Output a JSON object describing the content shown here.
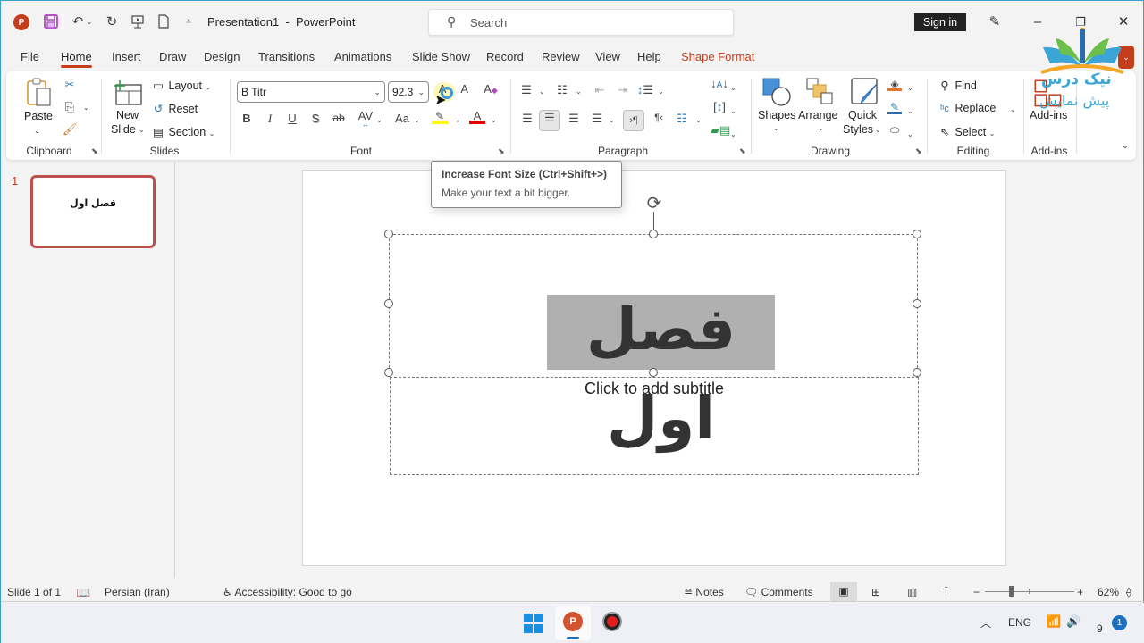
{
  "window": {
    "title": "Presentation1  -  PowerPoint",
    "search_placeholder": "Search",
    "sign_in_label": "Sign in"
  },
  "quick_access": {
    "icons": [
      "powerpoint-logo",
      "save-icon",
      "undo-icon",
      "redo-icon",
      "present-from-start-icon",
      "new-file-icon",
      "customize-qat-icon"
    ]
  },
  "tabs": [
    {
      "label": "File"
    },
    {
      "label": "Home",
      "active": true
    },
    {
      "label": "Insert"
    },
    {
      "label": "Draw"
    },
    {
      "label": "Design"
    },
    {
      "label": "Transitions"
    },
    {
      "label": "Animations"
    },
    {
      "label": "Slide Show"
    },
    {
      "label": "Record"
    },
    {
      "label": "Review"
    },
    {
      "label": "View"
    },
    {
      "label": "Help"
    },
    {
      "label": "Shape Format",
      "contextual": true
    }
  ],
  "ribbon": {
    "clipboard": {
      "label": "Clipboard",
      "paste": "Paste"
    },
    "slides": {
      "label": "Slides",
      "new_slide_line1": "New",
      "new_slide_line2": "Slide",
      "layout": "Layout",
      "reset": "Reset",
      "section": "Section"
    },
    "font": {
      "label": "Font",
      "font_name": "B Titr",
      "font_size": "92.3",
      "bold": "B",
      "italic": "I",
      "underline": "U",
      "shadow": "S",
      "strike": "ab",
      "spacing": "AV",
      "change_case": "Aa"
    },
    "paragraph": {
      "label": "Paragraph"
    },
    "drawing": {
      "label": "Drawing",
      "shapes": "Shapes",
      "arrange": "Arrange",
      "quick_styles_line1": "Quick",
      "quick_styles_line2": "Styles"
    },
    "editing": {
      "label": "Editing",
      "find": "Find",
      "replace": "Replace",
      "select": "Select"
    },
    "addins": {
      "label": "Add-ins",
      "addins_button": "Add-ins"
    }
  },
  "tooltip": {
    "title": "Increase Font Size (Ctrl+Shift+>)",
    "description": "Make your text a bit bigger."
  },
  "slide_pane": {
    "slides": [
      {
        "number": "1",
        "title": "فصل اول"
      }
    ]
  },
  "slide": {
    "title": "فصل اول",
    "subtitle_placeholder": "Click to add subtitle"
  },
  "status": {
    "slide_counter": "Slide 1 of 1",
    "language": "Persian (Iran)",
    "accessibility": "Accessibility: Good to go",
    "notes": "Notes",
    "comments": "Comments",
    "zoom_level": "62%"
  },
  "taskbar": {
    "language": "ENG",
    "time_partial": "9",
    "notification_count": "1"
  },
  "watermark": {
    "line1": "نیک درس",
    "line2": "پیش نمایش"
  },
  "colors": {
    "accent": "#c43e1c",
    "thumb_border": "#c0504d",
    "title_highlight": "#b0b0b0"
  }
}
